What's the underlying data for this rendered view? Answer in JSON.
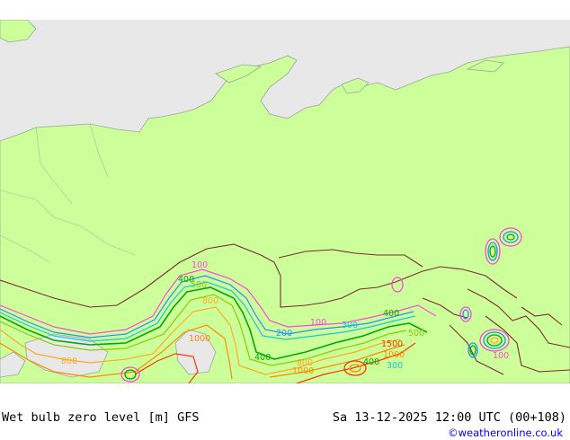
{
  "footer": {
    "title": "Wet bulb zero level [m] GFS",
    "datetime": "Sa 13-12-2025 12:00 UTC (00+108)",
    "credit": "©weatheronline.co.uk"
  },
  "colors": {
    "land": "#ccff99",
    "sea": "#e8e8e8",
    "border": "#7a2a35",
    "coast": "#9aa59a",
    "contour_100": "#ff44dd",
    "contour_200": "#2a8cff",
    "contour_300": "#19c6d8",
    "contour_400": "#00aa00",
    "contour_500": "#88cc00",
    "contour_800": "#ffaa22",
    "contour_1000": "#ff8800",
    "contour_1500": "#ff3300"
  },
  "contour_labels": [
    {
      "text": "100"
    },
    {
      "text": "100"
    },
    {
      "text": "100"
    },
    {
      "text": "200"
    },
    {
      "text": "300"
    },
    {
      "text": "400"
    },
    {
      "text": "400"
    },
    {
      "text": "400"
    },
    {
      "text": "500"
    },
    {
      "text": "800"
    },
    {
      "text": "800"
    },
    {
      "text": "800"
    },
    {
      "text": "1000"
    },
    {
      "text": "1000"
    },
    {
      "text": "1000"
    },
    {
      "text": "1500"
    },
    {
      "text": "300"
    },
    {
      "text": "400"
    },
    {
      "text": "500"
    }
  ]
}
